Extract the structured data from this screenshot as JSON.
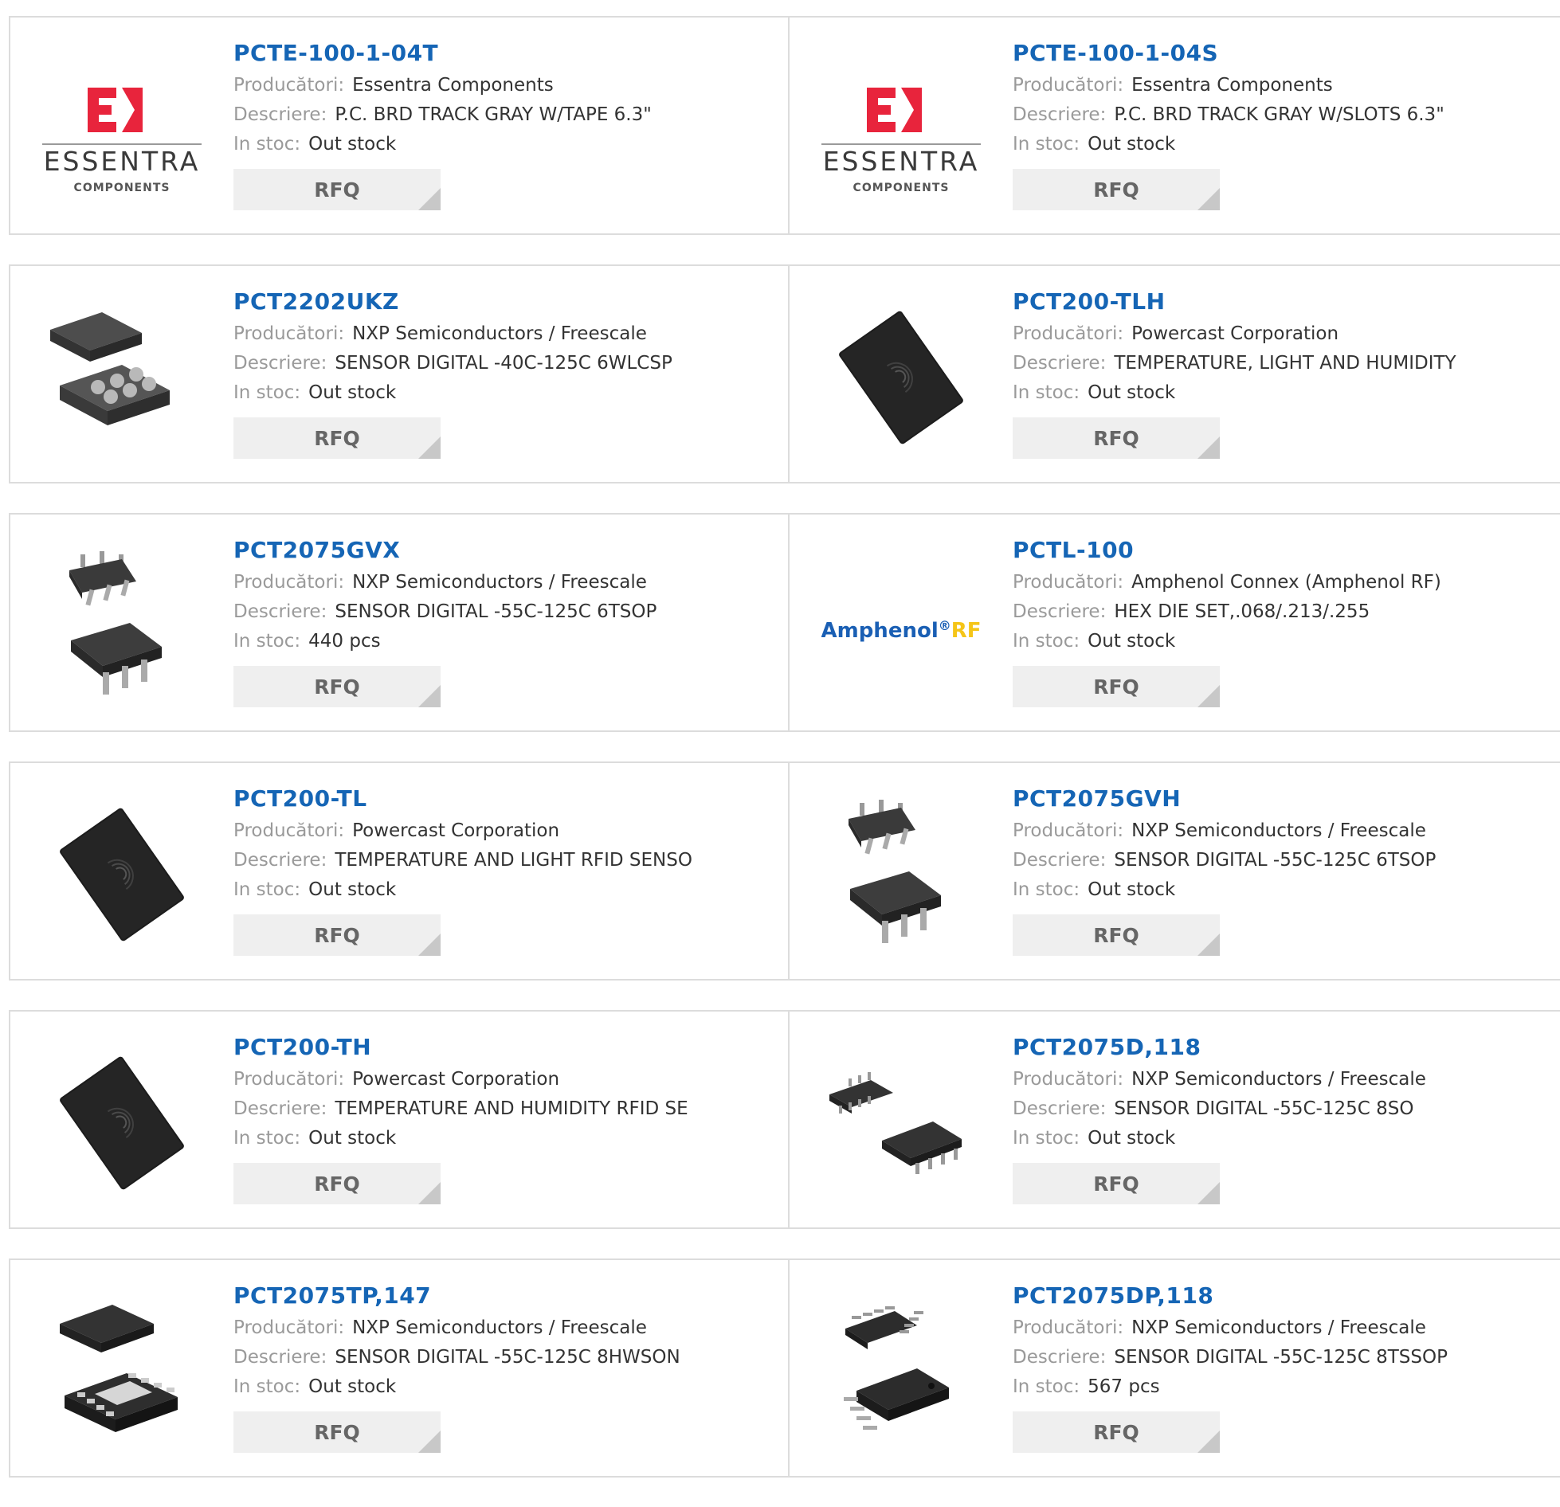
{
  "labels": {
    "manufacturer": "Producători:",
    "description": "Descriere:",
    "stock": "In stoc:",
    "rfq": "RFQ"
  },
  "brand_logos": {
    "essentra_word": "ESSENTRA",
    "essentra_sub": "COMPONENTS",
    "amphenol_word": "Amphenol",
    "amphenol_reg": "®",
    "amphenol_rf": "RF"
  },
  "colors": {
    "link": "#1565b5",
    "essentra_red": "#e8243c",
    "amphenol_blue": "#1a5fb4",
    "amphenol_yellow": "#f5c518"
  },
  "products": [
    {
      "name": "PCTE-100-1-04T",
      "manufacturer": "Essentra Components",
      "description": "P.C. BRD TRACK GRAY W/TAPE 6.3\"",
      "stock": "Out stock",
      "image": "essentra-logo"
    },
    {
      "name": "PCTE-100-1-04S",
      "manufacturer": "Essentra Components",
      "description": "P.C. BRD TRACK GRAY W/SLOTS 6.3\"",
      "stock": "Out stock",
      "image": "essentra-logo"
    },
    {
      "name": "PCT2202UKZ",
      "manufacturer": "NXP Semiconductors / Freescale",
      "description": "SENSOR DIGITAL -40C-125C 6WLCSP",
      "stock": "Out stock",
      "image": "wlcsp-chip"
    },
    {
      "name": "PCT200-TLH",
      "manufacturer": "Powercast Corporation",
      "description": "TEMPERATURE, LIGHT AND HUMIDITY",
      "stock": "Out stock",
      "image": "rfid-tag"
    },
    {
      "name": "PCT2075GVX",
      "manufacturer": "NXP Semiconductors / Freescale",
      "description": "SENSOR DIGITAL -55C-125C 6TSOP",
      "stock": "440 pcs",
      "image": "tsop6-chip"
    },
    {
      "name": "PCTL-100",
      "manufacturer": "Amphenol Connex (Amphenol RF)",
      "description": "HEX DIE SET,.068/.213/.255",
      "stock": "Out stock",
      "image": "amphenol-logo"
    },
    {
      "name": "PCT200-TL",
      "manufacturer": "Powercast Corporation",
      "description": "TEMPERATURE AND LIGHT RFID SENSO",
      "stock": "Out stock",
      "image": "rfid-tag"
    },
    {
      "name": "PCT2075GVH",
      "manufacturer": "NXP Semiconductors / Freescale",
      "description": "SENSOR DIGITAL -55C-125C 6TSOP",
      "stock": "Out stock",
      "image": "tsop6-chip"
    },
    {
      "name": "PCT200-TH",
      "manufacturer": "Powercast Corporation",
      "description": "TEMPERATURE AND HUMIDITY RFID SE",
      "stock": "Out stock",
      "image": "rfid-tag"
    },
    {
      "name": "PCT2075D,118",
      "manufacturer": "NXP Semiconductors / Freescale",
      "description": "SENSOR DIGITAL -55C-125C 8SO",
      "stock": "Out stock",
      "image": "so8-chip"
    },
    {
      "name": "PCT2075TP,147",
      "manufacturer": "NXP Semiconductors / Freescale",
      "description": "SENSOR DIGITAL -55C-125C 8HWSON",
      "stock": "Out stock",
      "image": "hwson-chip"
    },
    {
      "name": "PCT2075DP,118",
      "manufacturer": "NXP Semiconductors / Freescale",
      "description": "SENSOR DIGITAL -55C-125C 8TSSOP",
      "stock": "567 pcs",
      "image": "tssop8-chip"
    }
  ]
}
